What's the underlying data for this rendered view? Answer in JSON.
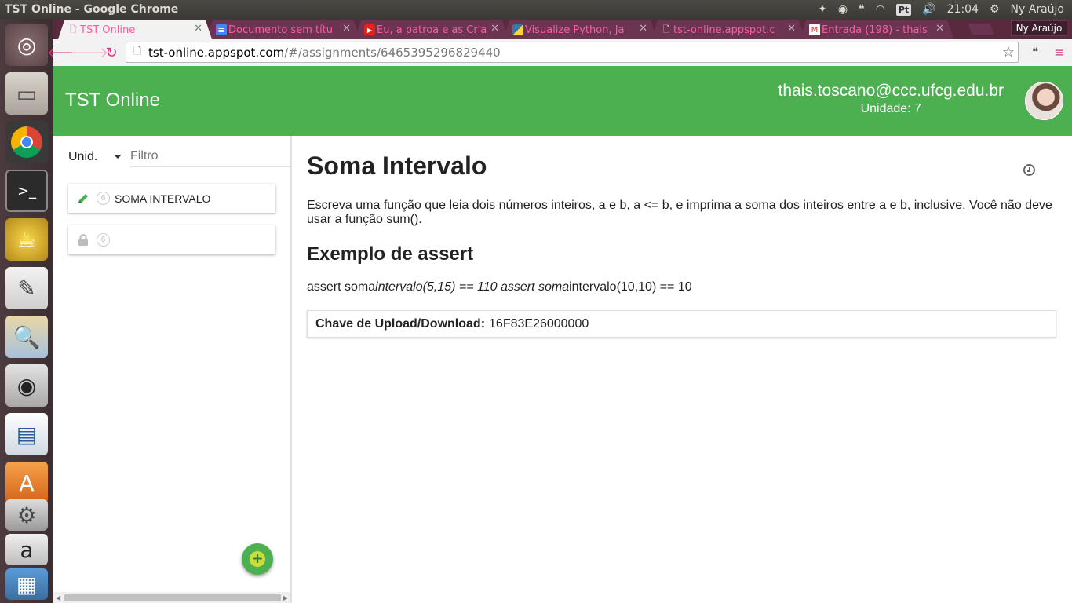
{
  "os": {
    "window_title": "TST Online - Google Chrome",
    "clock": "21:04",
    "user": "Ny Araújo",
    "keyboard_layout": "Pt"
  },
  "launcher": {
    "items": [
      "ubuntu-home",
      "files",
      "chrome",
      "terminal",
      "teapot-app",
      "text-editor",
      "image-viewer",
      "rhythmbox",
      "libreoffice-impress",
      "software-center",
      "system-settings",
      "amazon",
      "workspaces"
    ]
  },
  "browser": {
    "tabs": [
      {
        "title": "TST Online",
        "active": true,
        "icon": "page-icon"
      },
      {
        "title": "Documento sem títu",
        "active": false,
        "icon": "docs-icon"
      },
      {
        "title": "Eu, a patroa e as Cria",
        "active": false,
        "icon": "youtube-icon"
      },
      {
        "title": "Visualize Python, Ja",
        "active": false,
        "icon": "python-icon"
      },
      {
        "title": "tst-online.appspot.c",
        "active": false,
        "icon": "page-icon"
      },
      {
        "title": "Entrada (198) - thais",
        "active": false,
        "icon": "gmail-icon"
      }
    ],
    "profile": "Ny Araújo",
    "url_host": "tst-online.appspot.com",
    "url_path": "/#/assignments/6465395296829440"
  },
  "app": {
    "brand": "TST Online",
    "user_email": "thais.toscano@ccc.ufcg.edu.br",
    "unit_label": "Unidade: 7",
    "accent": "#4caf50"
  },
  "sidebar": {
    "unit_select": "Unid.",
    "filter_placeholder": "Filtro",
    "items": [
      {
        "badge": "6",
        "label": "SOMA INTERVALO",
        "icon": "pencil-icon"
      },
      {
        "badge": "6",
        "label": "",
        "icon": "lock-icon"
      }
    ],
    "fab": "+"
  },
  "assignment": {
    "title": "Soma Intervalo",
    "description": "Escreva uma função que leia dois números inteiros, a e b, a <= b, e imprima a soma dos inteiros entre a e b, inclusive. Você não deve usar a função sum().",
    "example_heading": "Exemplo de assert",
    "assert_parts": [
      "assert soma",
      "intervalo(5,15) == 110 assert soma",
      "intervalo(10,10) == 10"
    ],
    "key_label": "Chave de Upload/Download:",
    "key_value": "16F83E26000000"
  }
}
